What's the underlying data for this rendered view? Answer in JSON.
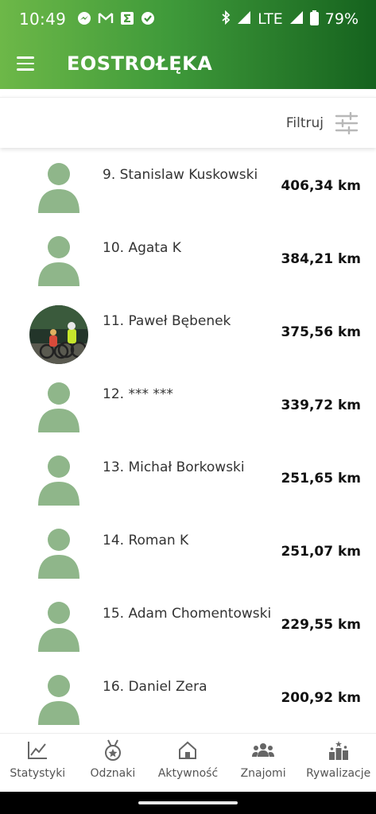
{
  "status_bar": {
    "time": "10:49",
    "notifications": [
      "messenger-icon",
      "gmail-icon",
      "sigma-icon",
      "check-badge-icon"
    ],
    "network": "LTE",
    "battery": "79%"
  },
  "app_bar": {
    "title": "EOSTROŁĘKA"
  },
  "filter": {
    "label": "Filtruj"
  },
  "leaderboard": [
    {
      "rank_name": "9. Stanislaw Kuskowski",
      "distance": "406,34 km",
      "avatar": "placeholder"
    },
    {
      "rank_name": "10. Agata K",
      "distance": "384,21 km",
      "avatar": "placeholder"
    },
    {
      "rank_name": "11. Paweł Bębenek",
      "distance": "375,56 km",
      "avatar": "photo"
    },
    {
      "rank_name": "12. *** ***",
      "distance": "339,72 km",
      "avatar": "placeholder"
    },
    {
      "rank_name": "13. Michał Borkowski",
      "distance": "251,65 km",
      "avatar": "placeholder"
    },
    {
      "rank_name": "14. Roman K",
      "distance": "251,07 km",
      "avatar": "placeholder"
    },
    {
      "rank_name": "15. Adam Chomentowski",
      "distance": "229,55 km",
      "avatar": "placeholder"
    },
    {
      "rank_name": "16. Daniel Zera",
      "distance": "200,92 km",
      "avatar": "placeholder"
    }
  ],
  "bottom_nav": [
    {
      "label": "Statystyki",
      "icon": "chart-icon"
    },
    {
      "label": "Odznaki",
      "icon": "medal-icon"
    },
    {
      "label": "Aktywność",
      "icon": "home-icon"
    },
    {
      "label": "Znajomi",
      "icon": "friends-icon"
    },
    {
      "label": "Rywalizacje",
      "icon": "podium-icon"
    }
  ],
  "colors": {
    "header_gradient_start": "#6db848",
    "header_gradient_end": "#15621e",
    "avatar_placeholder": "#8fb68a"
  }
}
